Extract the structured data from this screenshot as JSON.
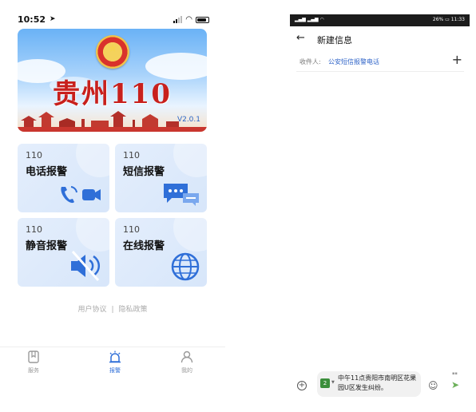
{
  "left_screen": {
    "status": {
      "time": "10:52"
    },
    "banner": {
      "title": "贵州110",
      "version": "V2.0.1"
    },
    "cards": [
      {
        "number": "110",
        "label": "电话报警"
      },
      {
        "number": "110",
        "label": "短信报警"
      },
      {
        "number": "110",
        "label": "静音报警"
      },
      {
        "number": "110",
        "label": "在线报警"
      }
    ],
    "links": {
      "agreement": "用户协议",
      "separator": "|",
      "privacy": "隐私政策"
    },
    "tabs": [
      {
        "label": "服务",
        "active": false
      },
      {
        "label": "报警",
        "active": true
      },
      {
        "label": "我的",
        "active": false
      }
    ]
  },
  "right_screen": {
    "status": {
      "battery": "26%",
      "time": "11:33"
    },
    "header": {
      "title": "新建信息"
    },
    "recipient": {
      "label": "收件人:",
      "value": "公安短信报警电话"
    },
    "composer": {
      "message": "中午11点贵阳市南明区花果园U区发生纠纷。",
      "sim": "2"
    }
  },
  "colors": {
    "accent": "#2f6fd8",
    "emblem_red": "#c8201c",
    "card_bg": "#dce9fb"
  }
}
